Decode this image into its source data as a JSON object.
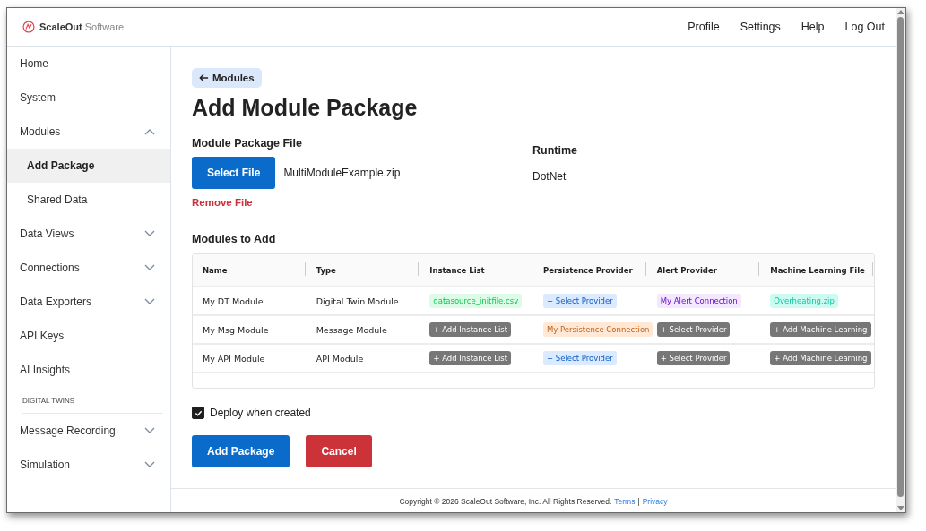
{
  "header": {
    "brand": {
      "name": "ScaleOut",
      "suffix": "Software"
    },
    "nav": [
      "Profile",
      "Settings",
      "Help",
      "Log Out"
    ]
  },
  "sidebar": {
    "sections": [
      {
        "items": [
          {
            "label": "Home",
            "selected": false
          },
          {
            "label": "System",
            "selected": false
          },
          {
            "label": "Modules",
            "selected": false,
            "expanded": true,
            "children": [
              {
                "label": "Add Package",
                "selected": true
              },
              {
                "label": "Shared Data",
                "selected": false
              }
            ]
          },
          {
            "label": "Data Views",
            "selected": false,
            "expanded": false
          },
          {
            "label": "Connections",
            "selected": false,
            "expanded": false
          },
          {
            "label": "Data Exporters",
            "selected": false,
            "expanded": false
          },
          {
            "label": "API Keys",
            "selected": false
          },
          {
            "label": "AI Insights",
            "selected": false
          }
        ]
      },
      {
        "heading": "DIGITAL TWINS",
        "items": [
          {
            "label": "Message Recording",
            "selected": false,
            "expanded": false
          },
          {
            "label": "Simulation",
            "selected": false,
            "expanded": false
          }
        ]
      }
    ]
  },
  "back_button": "Modules",
  "title": "Add Module Package",
  "package_file": {
    "label": "Module Package File",
    "button": "Select File",
    "file_name": "MultiModuleExample.zip",
    "remove": "Remove File"
  },
  "runtime": {
    "label": "Runtime",
    "value": "DotNet"
  },
  "modules": {
    "heading": "Modules to Add",
    "columns": [
      "Name",
      "Type",
      "Instance List",
      "Persistence Provider",
      "Alert Provider",
      "Machine Learning File"
    ],
    "rows": [
      {
        "cells": [
          {
            "kind": "text",
            "text": "My DT Module"
          },
          {
            "kind": "text",
            "text": "Digital Twin Module"
          },
          {
            "kind": "value",
            "text": "datasource_initfile.csv",
            "color": "#dcfce7"
          },
          {
            "kind": "pick",
            "text": "+ Select Provider",
            "color": "#dbeafe"
          },
          {
            "kind": "value",
            "text": "My Alert Connection",
            "color": "#f3e8ff"
          },
          {
            "kind": "value",
            "text": "Overheating.zip",
            "color": "#ccfbf1"
          }
        ]
      },
      {
        "cells": [
          {
            "kind": "text",
            "text": "My Msg Module"
          },
          {
            "kind": "text",
            "text": "Message Module"
          },
          {
            "kind": "add",
            "text": "+ Add Instance List"
          },
          {
            "kind": "value",
            "text": "My Persistence Connection",
            "color": "#ffe8d6"
          },
          {
            "kind": "add",
            "text": "+ Select Provider"
          },
          {
            "kind": "add",
            "text": "+ Add Machine Learning"
          }
        ]
      },
      {
        "cells": [
          {
            "kind": "text",
            "text": "My API Module"
          },
          {
            "kind": "text",
            "text": "API Module"
          },
          {
            "kind": "add",
            "text": "+ Add Instance List"
          },
          {
            "kind": "pick",
            "text": "+ Select Provider",
            "color": "#dbeafe"
          },
          {
            "kind": "add",
            "text": "+ Select Provider"
          },
          {
            "kind": "add",
            "text": "+ Add Machine Learning"
          }
        ]
      }
    ]
  },
  "deploy": {
    "label": "Deploy when created",
    "checked": true
  },
  "buttons": [
    {
      "kind": "primary",
      "label": "Add Package"
    },
    {
      "kind": "danger",
      "label": "Cancel"
    }
  ],
  "footer": {
    "text": "Copyright © 2026 ScaleOut Software, Inc. All Rights Reserved.",
    "links": [
      "Terms",
      "Privacy"
    ],
    "separator": "|"
  }
}
